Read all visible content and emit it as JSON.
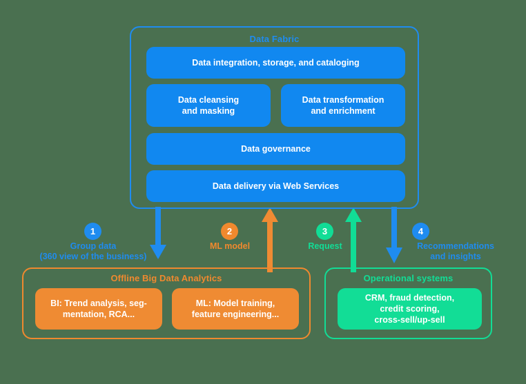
{
  "background_color": "#4a7050",
  "palette": {
    "blue": "#1f8cf0",
    "blue_card": "#1188f0",
    "orange": "#f0892e",
    "orange_card": "#ef8b33",
    "green": "#11dd96",
    "green_card": "#12dd96",
    "card_text": "#ffffff"
  },
  "data_fabric": {
    "title": "Data Fabric",
    "cards": [
      {
        "id": "integration",
        "label": "Data integration, storage, and cataloging"
      },
      {
        "id": "cleansing",
        "label": "Data cleansing\nand masking"
      },
      {
        "id": "transform",
        "label": "Data transformation\nand enrichment"
      },
      {
        "id": "governance",
        "label": "Data governance"
      },
      {
        "id": "delivery",
        "label": "Data delivery via Web Services"
      }
    ]
  },
  "offline_analytics": {
    "title": "Offline Big Data Analytics",
    "cards": [
      {
        "id": "bi",
        "label": "BI: Trend analysis, seg-\nmentation, RCA..."
      },
      {
        "id": "ml",
        "label": "ML: Model training,\nfeature engineering..."
      }
    ]
  },
  "operational_systems": {
    "title": "Operational systems",
    "cards": [
      {
        "id": "crm",
        "label": "CRM, fraud detection,\ncredit scoring,\ncross-sell/up-sell"
      }
    ]
  },
  "steps": [
    {
      "number": "1",
      "label": "Group data\n(360 view of the business)",
      "color": "#1f8cf0",
      "direction": "down",
      "arrow_name": "arrow-down-blue-group-data"
    },
    {
      "number": "2",
      "label": "ML model",
      "color": "#f0892e",
      "direction": "up",
      "arrow_name": "arrow-up-orange-ml-model"
    },
    {
      "number": "3",
      "label": "Request",
      "color": "#11dd96",
      "direction": "up",
      "arrow_name": "arrow-up-green-request"
    },
    {
      "number": "4",
      "label": "Recommendations\nand insights",
      "color": "#1f8cf0",
      "direction": "down",
      "arrow_name": "arrow-down-blue-recommendations"
    }
  ]
}
